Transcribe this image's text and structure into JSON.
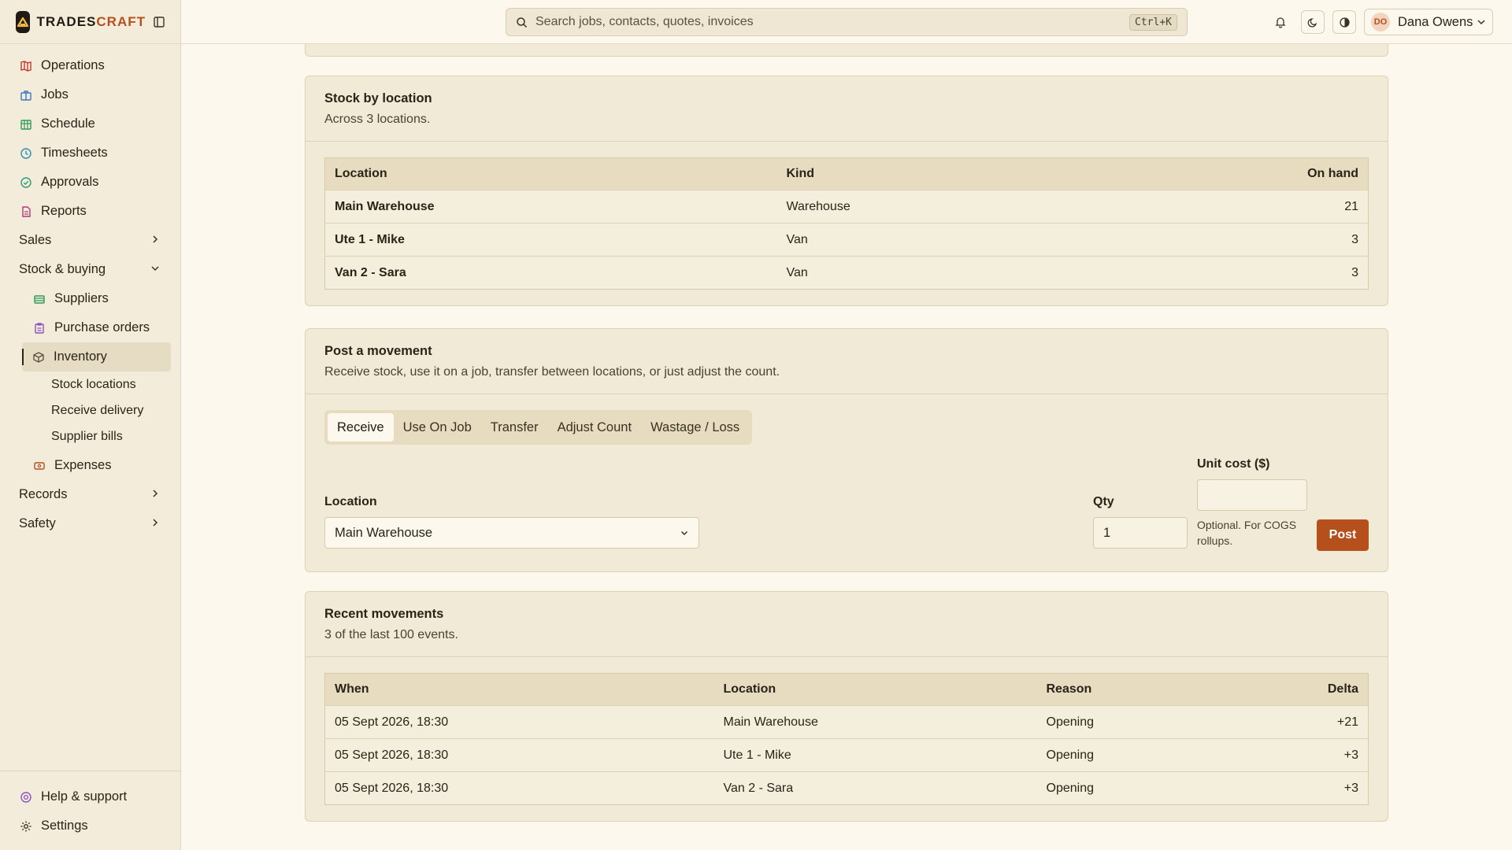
{
  "brand": {
    "name_part1": "TRADES",
    "name_part2": "CRAFT"
  },
  "search": {
    "placeholder": "Search jobs, contacts, quotes, invoices",
    "shortcut": "Ctrl+K"
  },
  "user": {
    "initials": "DO",
    "name": "Dana Owens"
  },
  "sidebar": {
    "items": [
      {
        "label": "Operations",
        "icon": "map-icon",
        "color": "#c0392b"
      },
      {
        "label": "Jobs",
        "icon": "briefcase-icon",
        "color": "#3a78c2"
      },
      {
        "label": "Schedule",
        "icon": "calendar-icon",
        "color": "#2e9a55"
      },
      {
        "label": "Timesheets",
        "icon": "clock-icon",
        "color": "#2a8fb0"
      },
      {
        "label": "Approvals",
        "icon": "check-circle-icon",
        "color": "#2e9a75"
      },
      {
        "label": "Reports",
        "icon": "document-icon",
        "color": "#b03a78"
      }
    ],
    "groups": {
      "sales": "Sales",
      "stock": "Stock & buying",
      "records": "Records",
      "safety": "Safety"
    },
    "stock_items": [
      {
        "label": "Suppliers",
        "icon": "truck-icon",
        "color": "#2e9a55"
      },
      {
        "label": "Purchase orders",
        "icon": "clipboard-icon",
        "color": "#8a4fc2"
      },
      {
        "label": "Inventory",
        "icon": "box-icon",
        "color": "#5a5040"
      }
    ],
    "inventory_sub": [
      "Stock locations",
      "Receive delivery",
      "Supplier bills"
    ],
    "expenses": "Expenses",
    "footer": {
      "help": "Help & support",
      "settings": "Settings"
    }
  },
  "stock_by_location": {
    "title": "Stock by location",
    "subtitle": "Across 3 locations.",
    "headers": {
      "location": "Location",
      "kind": "Kind",
      "on_hand": "On hand"
    },
    "rows": [
      {
        "location": "Main Warehouse",
        "kind": "Warehouse",
        "on_hand": "21"
      },
      {
        "location": "Ute 1 - Mike",
        "kind": "Van",
        "on_hand": "3"
      },
      {
        "location": "Van 2 - Sara",
        "kind": "Van",
        "on_hand": "3"
      }
    ]
  },
  "post_movement": {
    "title": "Post a movement",
    "subtitle": "Receive stock, use it on a job, transfer between locations, or just adjust the count.",
    "tabs": [
      "Receive",
      "Use On Job",
      "Transfer",
      "Adjust Count",
      "Wastage / Loss"
    ],
    "location_label": "Location",
    "location_value": "Main Warehouse",
    "qty_label": "Qty",
    "qty_value": "1",
    "unit_cost_label": "Unit cost ($)",
    "unit_cost_value": "",
    "unit_cost_hint": "Optional. For COGS rollups.",
    "post_button": "Post"
  },
  "recent_movements": {
    "title": "Recent movements",
    "subtitle": "3 of the last 100 events.",
    "headers": {
      "when": "When",
      "location": "Location",
      "reason": "Reason",
      "delta": "Delta"
    },
    "rows": [
      {
        "when": "05 Sept 2026, 18:30",
        "location": "Main Warehouse",
        "reason": "Opening",
        "delta": "+21"
      },
      {
        "when": "05 Sept 2026, 18:30",
        "location": "Ute 1 - Mike",
        "reason": "Opening",
        "delta": "+3"
      },
      {
        "when": "05 Sept 2026, 18:30",
        "location": "Van 2 - Sara",
        "reason": "Opening",
        "delta": "+3"
      }
    ]
  }
}
